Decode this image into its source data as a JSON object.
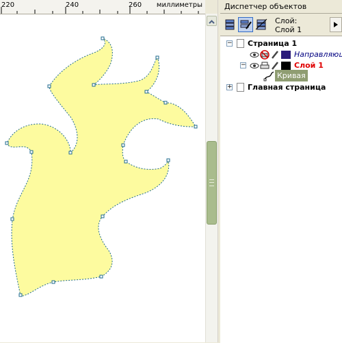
{
  "ruler": {
    "ticks": [
      "220",
      "240",
      "260"
    ],
    "units": "миллиметры"
  },
  "docker": {
    "title": "Диспетчер объектов",
    "layer_label": "Слой:",
    "layer_name": "Слой 1"
  },
  "tree": {
    "page1": "Страница 1",
    "guides": "Направляющие",
    "layer1": "Слой 1",
    "curve": "Кривая",
    "master": "Главная страница"
  },
  "colors": {
    "shape_fill": "#fdfb9f",
    "shape_outline": "#1d6a8c",
    "layer1_text": "#e00000",
    "guides_swatch": "#2a1a7a",
    "layer1_swatch": "#000000",
    "scroll_thumb": "#a9bc8d"
  }
}
